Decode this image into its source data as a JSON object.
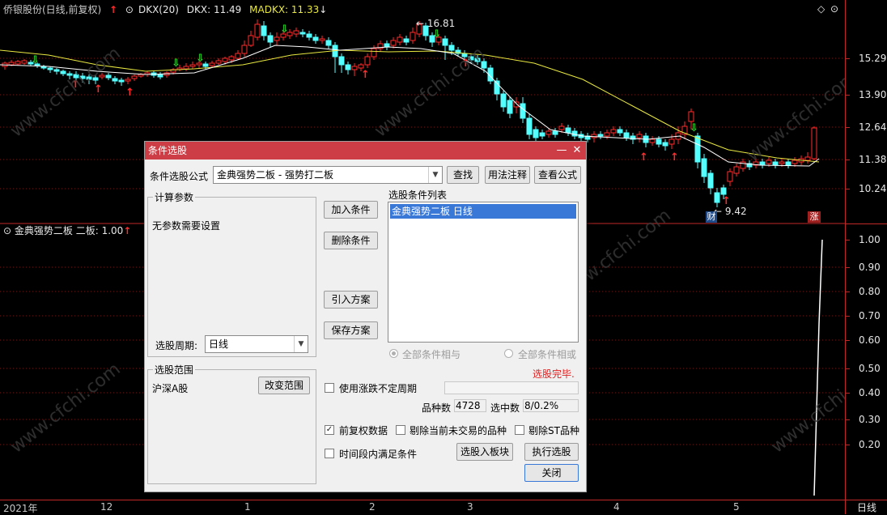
{
  "header": {
    "stock_title": "侨银股份(日线,前复权)",
    "up_arrow": "↑",
    "dkx_label": "DKX(20)",
    "dkx_value": "DKX: 11.49",
    "madkx_value": "MADKX: 11.33",
    "madkx_arrow": "↓"
  },
  "price_axis": [
    "15.29",
    "13.90",
    "12.64",
    "11.38",
    "10.24"
  ],
  "chart_labels": {
    "high": "16.81",
    "low": "9.42",
    "finance_badge": "财",
    "limit_badge": "涨"
  },
  "sub_panel": {
    "title": "金典强势二板  二板: 1.00",
    "arrow": "↑",
    "axis": [
      "1.00",
      "0.90",
      "0.80",
      "0.70",
      "0.60",
      "0.50",
      "0.40",
      "0.30",
      "0.20"
    ]
  },
  "time_axis": {
    "labels": [
      "2021年",
      "12",
      "1",
      "2",
      "3",
      "4",
      "5"
    ],
    "period": "日线"
  },
  "colors": {
    "up": "#ff2a2a",
    "down": "#54ffff",
    "dkx": "#ffffff",
    "madkx": "#e8e840",
    "grid": "#c02828",
    "dialog_title": "#cc3d45"
  },
  "dialog": {
    "title": "条件选股",
    "formula_label": "条件选股公式",
    "formula_value": "金典强势二板 - 强势打二板",
    "find_button": "查找",
    "usage_button": "用法注释",
    "view_button": "查看公式",
    "params_group": "计算参数",
    "params_text": "无参数需要设置",
    "period_label": "选股周期:",
    "period_value": "日线",
    "add_button": "加入条件",
    "delete_button": "删除条件",
    "import_button": "引入方案",
    "save_button": "保存方案",
    "list_label": "选股条件列表",
    "list_items": [
      "金典强势二板  日线"
    ],
    "radio_and": "全部条件相与",
    "radio_or": "全部条件相或",
    "status_text": "选股完毕.",
    "range_group": "选股范围",
    "range_value": "沪深A股",
    "change_range_button": "改变范围",
    "uncertain_period_label": "使用涨跌不定周期",
    "count_label": "品种数",
    "count_value": "4728",
    "selected_label": "选中数",
    "selected_value": "8/0.2%",
    "pre_adjust_label": "前复权数据",
    "exclude_suspended_label": "剔除当前未交易的品种",
    "exclude_st_label": "剔除ST品种",
    "time_range_label": "时间段内满足条件",
    "to_block_button": "选股入板块",
    "execute_button": "执行选股",
    "close_button": "关闭",
    "checks": {
      "uncertain_period": false,
      "pre_adjust": true,
      "exclude_suspended": false,
      "exclude_st": false,
      "time_range": false
    }
  }
}
